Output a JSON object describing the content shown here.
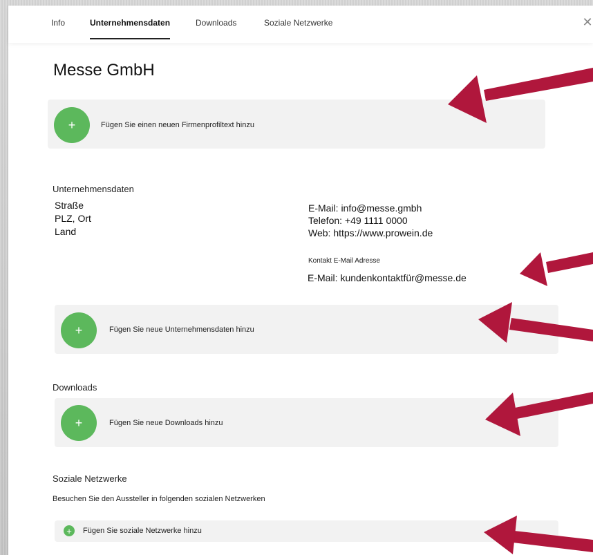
{
  "tabs": [
    {
      "label": "Info",
      "active": false
    },
    {
      "label": "Unternehmensdaten",
      "active": true
    },
    {
      "label": "Downloads",
      "active": false
    },
    {
      "label": "Soziale Netzwerke",
      "active": false
    }
  ],
  "company": {
    "name": "Messe GmbH"
  },
  "profile": {
    "add_label": "Fügen Sie einen neuen Firmenprofiltext hinzu"
  },
  "company_data": {
    "heading": "Unternehmensdaten",
    "street": "Straße",
    "zip_city": "PLZ, Ort",
    "country": "Land",
    "email": "E-Mail: info@messe.gmbh",
    "phone": "Telefon: +49 1111 0000",
    "web": "Web: https://www.prowein.de",
    "contact_label": "Kontakt E-Mail Adresse",
    "contact_email": "E-Mail: kundenkontaktfür@messe.de",
    "add_label": "Fügen Sie neue Unternehmensdaten hinzu"
  },
  "downloads": {
    "heading": "Downloads",
    "add_label": "Fügen Sie neue Downloads hinzu"
  },
  "social": {
    "heading": "Soziale Netzwerke",
    "subheading": "Besuchen Sie den Aussteller in folgenden sozialen Netzwerken",
    "add_label": "Fügen Sie soziale Netzwerke hinzu"
  },
  "icons": {
    "plus": "plus-icon",
    "close": "close-icon"
  },
  "colors": {
    "accent_green": "#5cb85c",
    "arrow_red": "#b0173c",
    "box_bg": "#f2f2f2"
  }
}
